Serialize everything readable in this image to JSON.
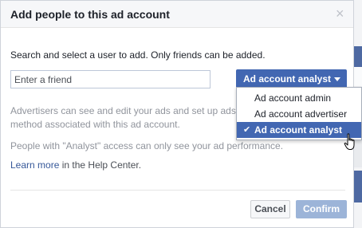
{
  "dialog": {
    "title": "Add people to this ad account",
    "close_glyph": "×",
    "intro": "Search and select a user to add. Only friends can be added.",
    "friend_input": {
      "placeholder": "Enter a friend",
      "value": ""
    },
    "role_select": {
      "selected": "Ad account analyst"
    },
    "description_line1": "Advertisers can see and edit your ads and set up ads",
    "description_line2": "method associated with this ad account.",
    "analyst_note": "People with \"Analyst\" access can only see your ad performance.",
    "help_link": "Learn more",
    "help_suffix": " in the Help Center.",
    "cancel_label": "Cancel",
    "confirm_label": "Confirm"
  },
  "dropdown": {
    "options": [
      "Ad account admin",
      "Ad account advertiser",
      "Ad account analyst"
    ],
    "selected_index": 2,
    "check_glyph": "✔"
  },
  "colors": {
    "accent": "#4267b2",
    "confirm_disabled": "#9cb4d8",
    "link": "#365899",
    "muted_text": "#90949c"
  },
  "icons": [
    "close-icon",
    "chevron-down-icon",
    "checkmark-icon",
    "hand-pointer-icon"
  ]
}
